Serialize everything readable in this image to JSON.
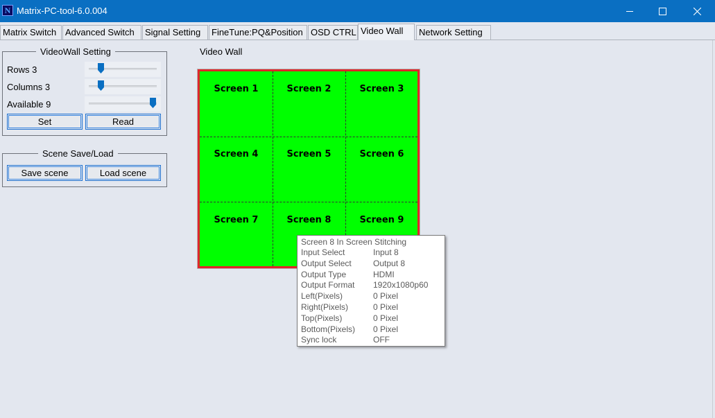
{
  "window": {
    "title": "Matrix-PC-tool-6.0.004",
    "icon_letter": "N",
    "controls": [
      "minimize-icon",
      "maximize-icon",
      "close-icon"
    ]
  },
  "tabs": [
    {
      "label": "Matrix Switch",
      "active": false
    },
    {
      "label": "Advanced Switch",
      "active": false
    },
    {
      "label": "Signal Setting",
      "active": false
    },
    {
      "label": "FineTune:PQ&Position",
      "active": false
    },
    {
      "label": "OSD CTRL",
      "active": false
    },
    {
      "label": "Video Wall",
      "active": true
    },
    {
      "label": "Network Setting",
      "active": false
    }
  ],
  "videowall_setting": {
    "title": "VideoWall Setting",
    "rows_label": "Rows 3",
    "rows_value": 3,
    "columns_label": "Columns 3",
    "columns_value": 3,
    "available_label": "Available 9",
    "available_value": 9,
    "set_button": "Set",
    "read_button": "Read"
  },
  "scene": {
    "title": "Scene Save/Load",
    "save_button": "Save scene",
    "load_button": "Load scene"
  },
  "video_wall": {
    "label": "Video Wall",
    "rows": 3,
    "columns": 3,
    "screens": [
      "Screen 1",
      "Screen 2",
      "Screen 3",
      "Screen 4",
      "Screen 5",
      "Screen 6",
      "Screen 7",
      "Screen 8",
      "Screen 9"
    ],
    "fill_color": "#00ff00",
    "border_color": "#e1242a"
  },
  "tooltip": {
    "header": "Screen 8  In Screen Stitching",
    "rows": [
      {
        "key": "Input Select",
        "value": "Input 8"
      },
      {
        "key": "Output Select",
        "value": "Output 8"
      },
      {
        "key": "Output Type",
        "value": "HDMI"
      },
      {
        "key": "Output Format",
        "value": "1920x1080p60"
      },
      {
        "key": "Left(Pixels)",
        "value": "0 Pixel"
      },
      {
        "key": "Right(Pixels)",
        "value": "0 Pixel"
      },
      {
        "key": "Top(Pixels)",
        "value": "0 Pixel"
      },
      {
        "key": "Bottom(Pixels)",
        "value": "0 Pixel"
      },
      {
        "key": "Sync lock",
        "value": "OFF"
      }
    ]
  },
  "colors": {
    "titlebar": "#0a6fc2",
    "accent": "#1c6fd0",
    "background": "#e3e7ef"
  }
}
